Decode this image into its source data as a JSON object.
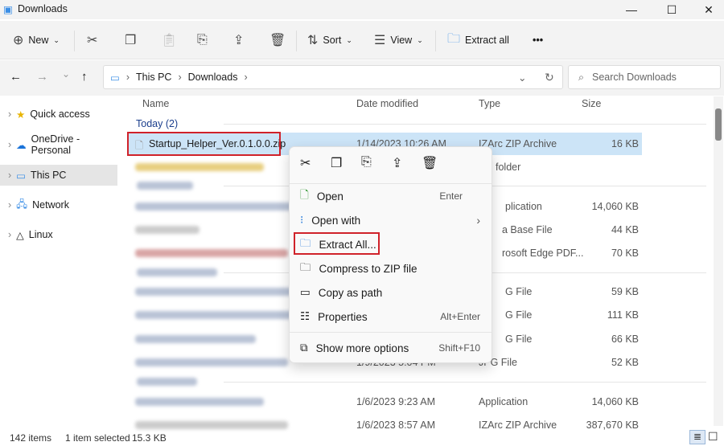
{
  "window": {
    "title": "Downloads"
  },
  "toolbar": {
    "new": "New",
    "sort": "Sort",
    "view": "View",
    "extract_all": "Extract all",
    "more": "•••"
  },
  "address": {
    "crumbs": [
      "This PC",
      "Downloads"
    ],
    "search_placeholder": "Search Downloads"
  },
  "sidebar": {
    "items": [
      {
        "label": "Quick access",
        "icon": "star-icon"
      },
      {
        "label": "OneDrive - Personal",
        "icon": "cloud-icon"
      },
      {
        "label": "This PC",
        "icon": "monitor-icon"
      },
      {
        "label": "Network",
        "icon": "network-icon"
      },
      {
        "label": "Linux",
        "icon": "penguin-icon"
      }
    ]
  },
  "columns": {
    "name": "Name",
    "date": "Date modified",
    "type": "Type",
    "size": "Size"
  },
  "groups": {
    "today": "Today (2)"
  },
  "files": [
    {
      "name": "Startup_Helper_Ver.0.1.0.0.zip",
      "date": "1/14/2023 10:26 AM",
      "type": "IZArc ZIP Archive",
      "size": "16 KB"
    },
    {
      "type": "folder"
    },
    {
      "type": "plication",
      "size": "14,060 KB"
    },
    {
      "type": "a Base File",
      "size": "44 KB"
    },
    {
      "type": "rosoft Edge PDF...",
      "size": "70 KB"
    },
    {
      "type": "G File",
      "size": "59 KB"
    },
    {
      "type": "G File",
      "size": "111 KB"
    },
    {
      "type": "G File",
      "size": "66 KB"
    },
    {
      "date": "1/9/2023 5:04 PM",
      "type": "JPG File",
      "size": "52 KB"
    },
    {
      "date": "1/6/2023 9:23 AM",
      "type": "Application",
      "size": "14,060 KB"
    },
    {
      "date": "1/6/2023 8:57 AM",
      "type": "IZArc ZIP Archive",
      "size": "387,670 KB"
    }
  ],
  "context_menu": {
    "items": [
      {
        "label": "Open",
        "shortcut": "Enter"
      },
      {
        "label": "Open with"
      },
      {
        "label": "Extract All..."
      },
      {
        "label": "Compress to ZIP file"
      },
      {
        "label": "Copy as path"
      },
      {
        "label": "Properties",
        "shortcut": "Alt+Enter"
      },
      {
        "label": "Show more options",
        "shortcut": "Shift+F10"
      }
    ]
  },
  "status": {
    "count": "142 items",
    "selected": "1 item selected",
    "size": "15.3 KB"
  }
}
